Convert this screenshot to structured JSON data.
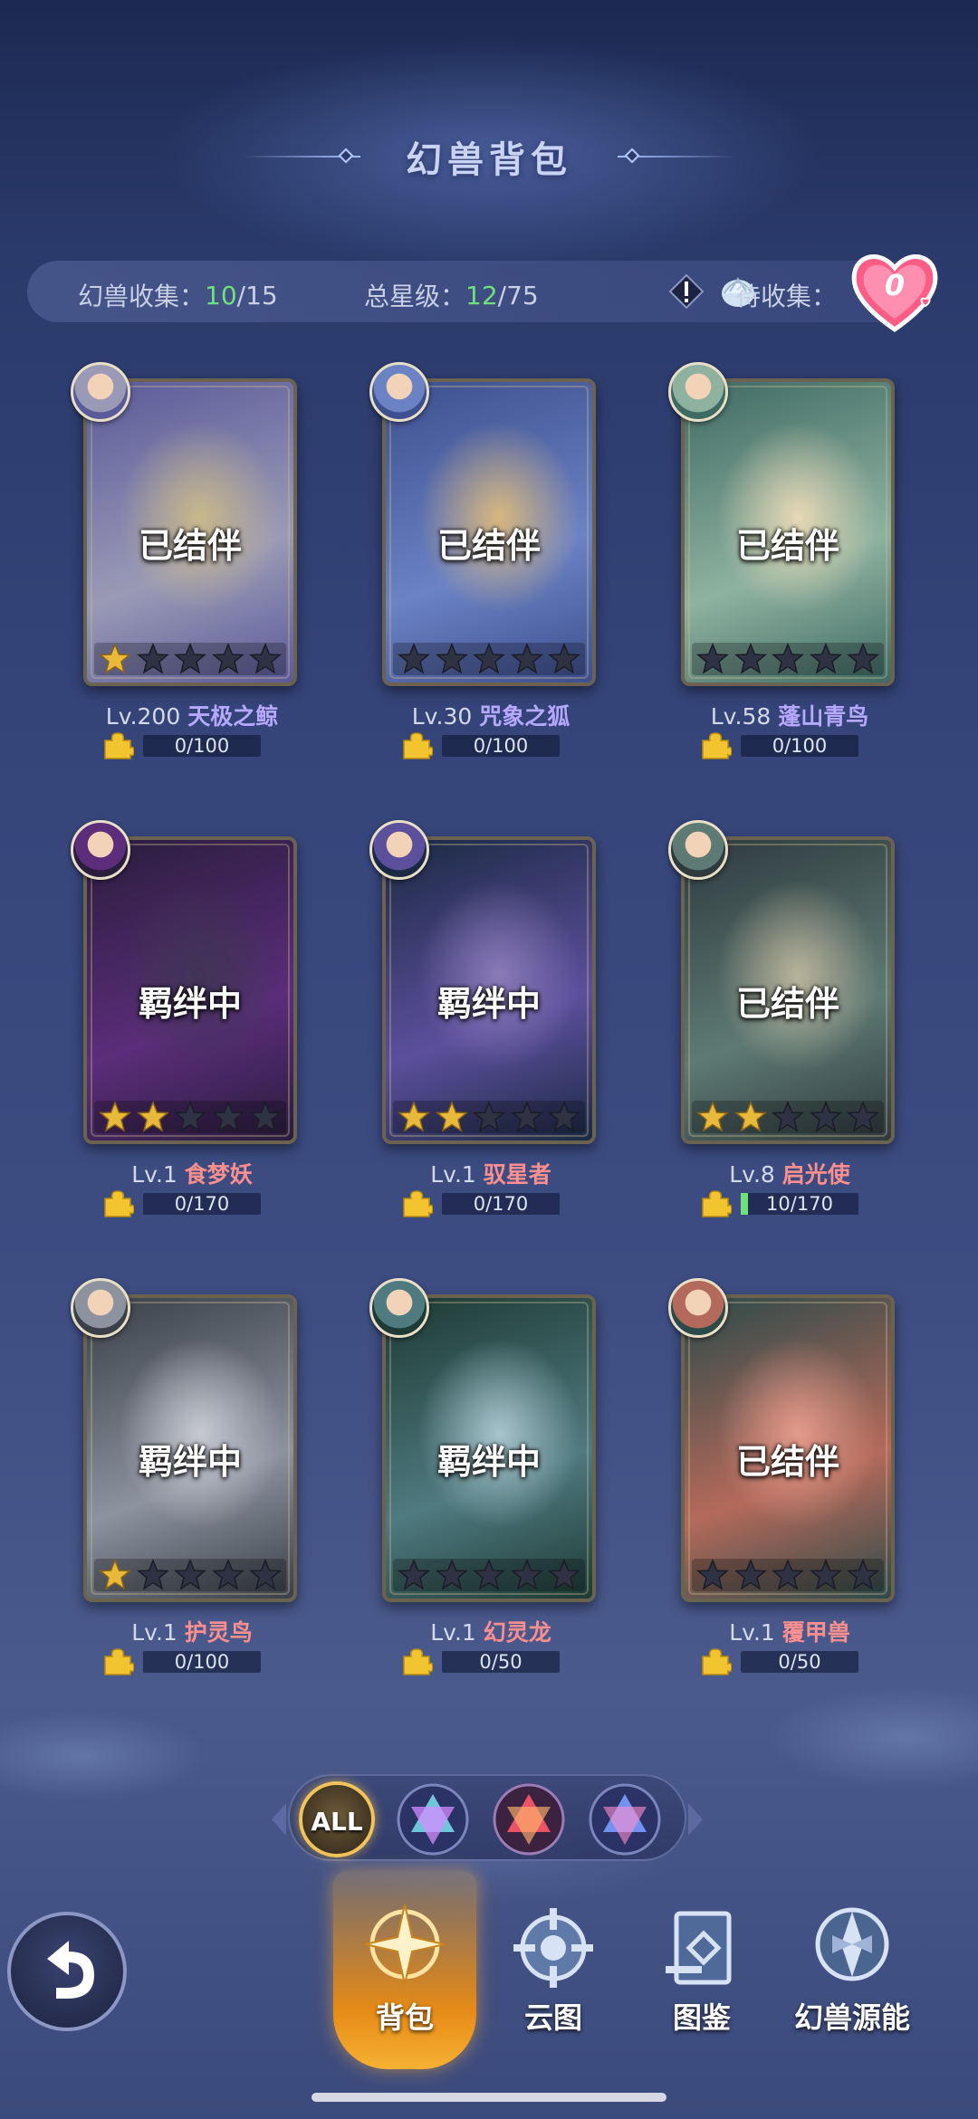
{
  "header": {
    "title": "幻兽背包"
  },
  "stats": {
    "collect_label": "幻兽收集：",
    "collect_value": "10",
    "collect_total": "/15",
    "star_label": "总星级：",
    "star_value": "12",
    "star_total": "/75",
    "pending_label": "待收集：",
    "pending_count": "0"
  },
  "cards": [
    {
      "status": "已结伴",
      "level": "Lv.200",
      "name": "天极之鲸",
      "progress": "0/100",
      "progress_fraction": 0,
      "stars": 1,
      "name_color": "#b7a8ff",
      "art": [
        "#5a5a9a",
        "#9a9ab6",
        "#c8b88a"
      ]
    },
    {
      "status": "已结伴",
      "level": "Lv.30",
      "name": "咒象之狐",
      "progress": "0/100",
      "progress_fraction": 0,
      "stars": 0,
      "name_color": "#b7a8ff",
      "art": [
        "#3d4f8e",
        "#6b82c4",
        "#d8b77e"
      ]
    },
    {
      "status": "已结伴",
      "level": "Lv.58",
      "name": "蓬山青鸟",
      "progress": "0/100",
      "progress_fraction": 0,
      "stars": 0,
      "name_color": "#b7a8ff",
      "art": [
        "#3f6a64",
        "#8fb2a0",
        "#e6d8b6"
      ]
    },
    {
      "status": "羁绊中",
      "level": "Lv.1",
      "name": "食梦妖",
      "progress": "0/170",
      "progress_fraction": 0,
      "stars": 2,
      "name_color": "#ff8f8f",
      "art": [
        "#2a1d3d",
        "#5b2d7a",
        "#3f3554"
      ]
    },
    {
      "status": "羁绊中",
      "level": "Lv.1",
      "name": "驭星者",
      "progress": "0/170",
      "progress_fraction": 0,
      "stars": 2,
      "name_color": "#ff8f8f",
      "art": [
        "#1b2a44",
        "#5c4f9c",
        "#8a7ab8"
      ]
    },
    {
      "status": "已结伴",
      "level": "Lv.8",
      "name": "启光使",
      "progress": "10/170",
      "progress_fraction": 0.06,
      "stars": 2,
      "name_color": "#ff8f8f",
      "art": [
        "#2f3a3e",
        "#5e7a74",
        "#b9b39a"
      ]
    },
    {
      "status": "羁绊中",
      "level": "Lv.1",
      "name": "护灵鸟",
      "progress": "0/100",
      "progress_fraction": 0,
      "stars": 1,
      "name_color": "#ff8f8f",
      "art": [
        "#3a4048",
        "#8c929e",
        "#c6c9d2"
      ]
    },
    {
      "status": "羁绊中",
      "level": "Lv.1",
      "name": "幻灵龙",
      "progress": "0/50",
      "progress_fraction": 0,
      "stars": 0,
      "name_color": "#ff8f8f",
      "art": [
        "#1e3a34",
        "#4f7a80",
        "#a8c4cc"
      ]
    },
    {
      "status": "已结伴",
      "level": "Lv.1",
      "name": "覆甲兽",
      "progress": "0/50",
      "progress_fraction": 0,
      "stars": 0,
      "name_color": "#ff8f8f",
      "art": [
        "#2d4a4a",
        "#b46a5a",
        "#e39a8a"
      ]
    }
  ],
  "filters": [
    {
      "label": "ALL",
      "selected": true
    },
    {
      "icon": "rainbow-gem-icon"
    },
    {
      "icon": "red-gem-icon"
    },
    {
      "icon": "blue-gem-icon"
    }
  ],
  "nav": {
    "items": [
      {
        "label": "背包",
        "icon": "compass-star-icon",
        "active": true
      },
      {
        "label": "云图",
        "icon": "cloud-map-icon",
        "active": false
      },
      {
        "label": "图鉴",
        "icon": "codex-book-icon",
        "active": false
      },
      {
        "label": "幻兽源能",
        "icon": "beast-energy-icon",
        "active": false
      }
    ]
  },
  "colors": {
    "accent_green": "#6fe07a",
    "active_nav": "#e58a16"
  }
}
